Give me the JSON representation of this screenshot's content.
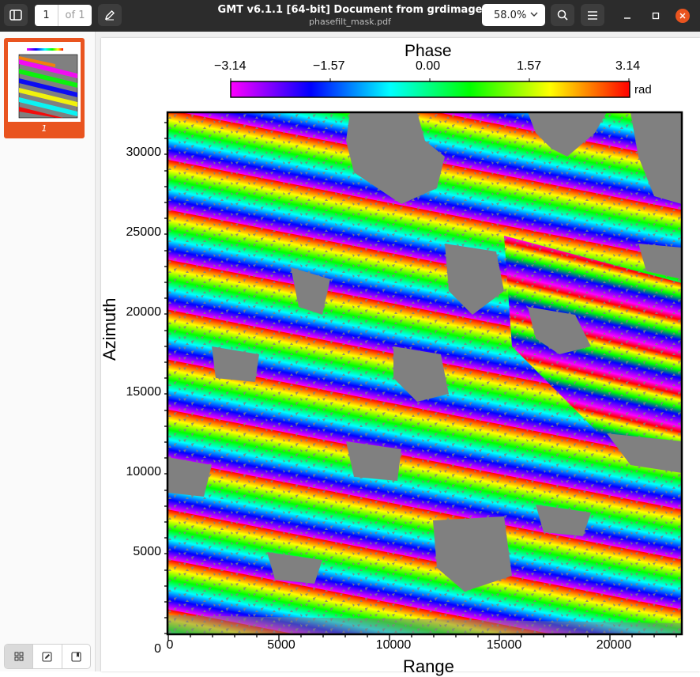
{
  "window": {
    "title": "GMT v6.1.1 [64-bit] Document from grdimage",
    "filename": "phasefilt_mask.pdf",
    "page_current": "1",
    "page_total": "of 1",
    "zoom": "58.0%"
  },
  "icons": {
    "sidebar_toggle": "sidebar-toggle-icon",
    "annotate": "pencil-icon",
    "search": "search-icon",
    "menu": "hamburger-menu-icon",
    "minimize": "minimize-icon",
    "maximize": "maximize-icon",
    "close": "close-icon",
    "zoom_dropdown": "chevron-down-icon",
    "thumbnails": "grid-icon",
    "annotations": "pencil-icon",
    "bookmarks": "bookmark-icon"
  },
  "sidebar": {
    "thumbnail_label": "1"
  },
  "colors": {
    "accent": "#e9541f",
    "close_button": "#e9541f",
    "titlebar": "#2c2c2c",
    "mask_gray": "#808080"
  },
  "figure": {
    "colorbar": {
      "title": "Phase",
      "ticks": [
        "−3.14",
        "−1.57",
        "0.00",
        "1.57",
        "3.14"
      ],
      "unit": "rad",
      "colors": [
        "#ff00ff",
        "#8000ff",
        "#0000ff",
        "#0080ff",
        "#00ffff",
        "#00ff80",
        "#00ff00",
        "#80ff00",
        "#ffff00",
        "#ff8000",
        "#ff0000"
      ]
    },
    "xlabel": "Range",
    "ylabel": "Azimuth",
    "xticks": [
      "0",
      "5000",
      "10000",
      "15000",
      "20000"
    ],
    "yticks": [
      "0",
      "5000",
      "10000",
      "15000",
      "20000",
      "25000",
      "30000"
    ],
    "xlim": [
      0,
      23400
    ],
    "ylim": [
      0,
      32500
    ]
  },
  "chart_data": {
    "type": "heatmap",
    "title": "Phase",
    "xlabel": "Range",
    "ylabel": "Azimuth",
    "xlim": [
      0,
      23400
    ],
    "ylim": [
      0,
      32500
    ],
    "colorbar_range": [
      -3.14,
      3.14
    ],
    "colorbar_ticks": [
      -3.14,
      -1.57,
      0.0,
      1.57,
      3.14
    ],
    "colorbar_unit": "rad",
    "colormap": "cyclic rainbow (magenta-blue-cyan-green-yellow-red)",
    "masked_color": "gray"
  }
}
